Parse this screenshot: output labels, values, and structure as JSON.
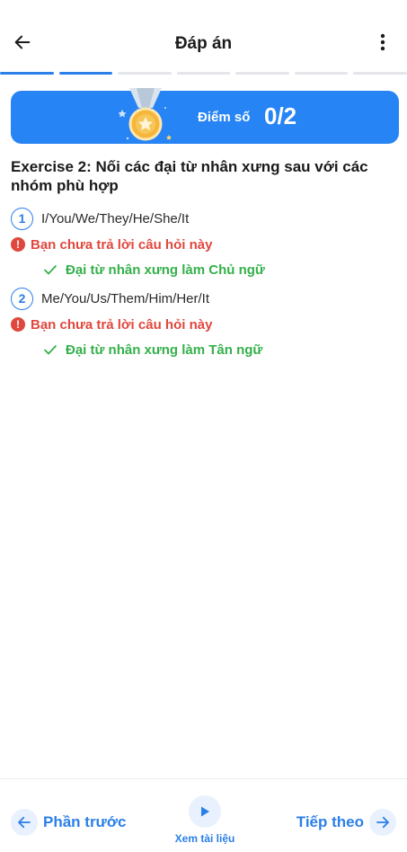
{
  "header": {
    "title": "Đáp án",
    "back_icon": "arrow-left-icon",
    "menu_icon": "more-vertical-icon"
  },
  "progress": {
    "total_segments": 7,
    "completed_segments": 2,
    "accent": "#2b7fe8"
  },
  "score": {
    "label": "Điểm số",
    "value": "0/2",
    "banner_color": "#2684f4",
    "icon": "medal-icon"
  },
  "exercise": {
    "title": "Exercise 2: Nối các đại từ nhân xưng sau với các nhóm phù hợp"
  },
  "questions": [
    {
      "number": "1",
      "text": "I/You/We/They/He/She/It",
      "status": "Bạn chưa trả lời câu hỏi này",
      "answer": "Đại từ nhân xưng làm Chủ ngữ"
    },
    {
      "number": "2",
      "text": "Me/You/Us/Them/Him/Her/It",
      "status": "Bạn chưa trả lời câu hỏi này",
      "answer": "Đại từ nhân xưng làm Tân ngữ"
    }
  ],
  "colors": {
    "error": "#e0473d",
    "correct": "#35b04a"
  },
  "footer": {
    "prev_label": "Phần trước",
    "docs_label": "Xem tài liệu",
    "next_label": "Tiếp theo"
  }
}
